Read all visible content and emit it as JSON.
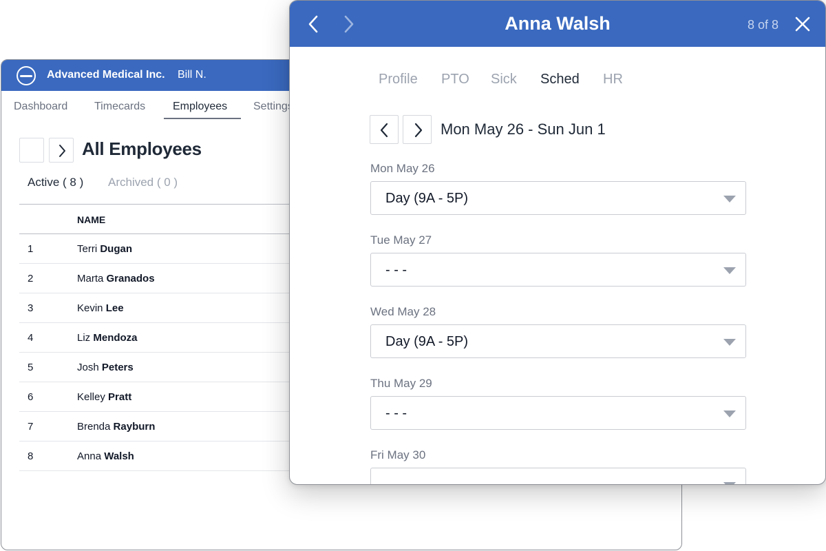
{
  "app": {
    "company": "Advanced Medical Inc.",
    "user": "Bill N.",
    "accent_color": "#3a69bf",
    "nav": [
      {
        "label": "Dashboard"
      },
      {
        "label": "Timecards"
      },
      {
        "label": "Employees",
        "active": true
      },
      {
        "label": "Settings"
      }
    ],
    "page_title": "All Employees",
    "sub_tabs": [
      {
        "label": "Active ( 8 )",
        "active": true
      },
      {
        "label": "Archived ( 0 )"
      }
    ],
    "table": {
      "header_name": "NAME",
      "rows": [
        {
          "num": "1",
          "first": "Terri",
          "last": "Dugan"
        },
        {
          "num": "2",
          "first": "Marta",
          "last": "Granados"
        },
        {
          "num": "3",
          "first": "Kevin",
          "last": "Lee"
        },
        {
          "num": "4",
          "first": "Liz",
          "last": "Mendoza"
        },
        {
          "num": "5",
          "first": "Josh",
          "last": "Peters"
        },
        {
          "num": "6",
          "first": "Kelley",
          "last": "Pratt"
        },
        {
          "num": "7",
          "first": "Brenda",
          "last": "Rayburn"
        },
        {
          "num": "8",
          "first": "Anna",
          "last": "Walsh"
        }
      ]
    }
  },
  "modal": {
    "title": "Anna Walsh",
    "counter": "8 of 8",
    "tabs": [
      {
        "label": "Profile"
      },
      {
        "label": "PTO"
      },
      {
        "label": "Sick"
      },
      {
        "label": "Sched",
        "active": true
      },
      {
        "label": "HR"
      }
    ],
    "week_range": "Mon May 26 - Sun Jun 1",
    "days": [
      {
        "label": "Mon May 26",
        "value": "Day (9A - 5P)"
      },
      {
        "label": "Tue May 27",
        "value": "- - -"
      },
      {
        "label": "Wed May 28",
        "value": "Day (9A - 5P)"
      },
      {
        "label": "Thu May 29",
        "value": "- - -"
      },
      {
        "label": "Fri May 30",
        "value": "- - -"
      }
    ]
  }
}
